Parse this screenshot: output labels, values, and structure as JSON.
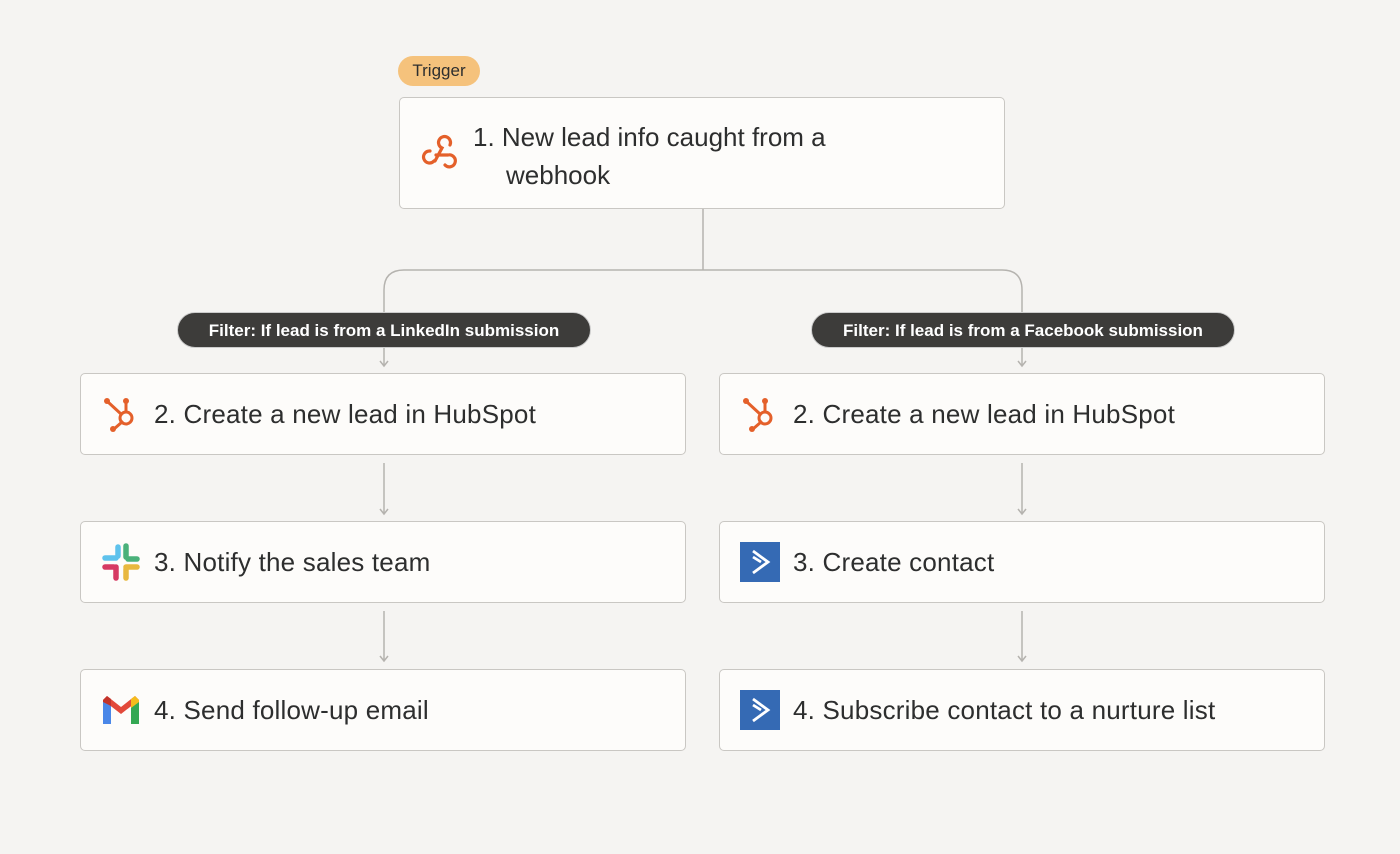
{
  "trigger": {
    "badge": "Trigger",
    "title_line1": "1. New lead info caught from a",
    "title_line2": "webhook",
    "icon": "webhook-icon"
  },
  "branches": [
    {
      "filter": "Filter: If lead is from a LinkedIn submission",
      "steps": [
        {
          "label": "2. Create a new lead in HubSpot",
          "icon": "hubspot-icon"
        },
        {
          "label": "3. Notify the sales team",
          "icon": "slack-icon"
        },
        {
          "label": "4. Send follow-up email",
          "icon": "gmail-icon"
        }
      ]
    },
    {
      "filter": "Filter: If lead is from a Facebook submission",
      "steps": [
        {
          "label": "2. Create a new lead in HubSpot",
          "icon": "hubspot-icon"
        },
        {
          "label": "3. Create contact",
          "icon": "activecampaign-icon"
        },
        {
          "label": "4. Subscribe contact to a nurture list",
          "icon": "activecampaign-icon"
        }
      ]
    }
  ],
  "colors": {
    "accent": "#e4602a",
    "badge": "#f5c27c",
    "pill": "#3d3c3a",
    "activecampaign": "#356ab4"
  }
}
